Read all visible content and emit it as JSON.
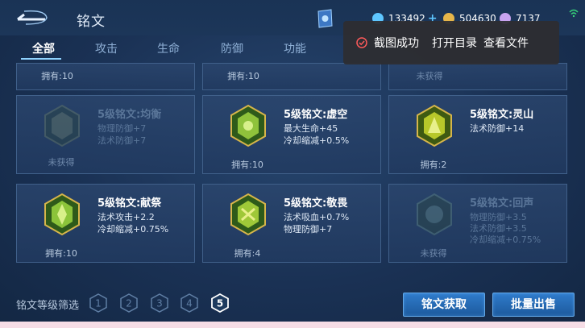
{
  "header": {
    "title": "铭文",
    "currencies": [
      {
        "icon": "diamond-icon",
        "value": "133492",
        "color": "#5ec6ff"
      },
      {
        "icon": "gold-coin-icon",
        "value": "504630",
        "color": "#e5b54a"
      },
      {
        "icon": "gem-icon",
        "value": "7137",
        "color": "#c8a3f0"
      }
    ]
  },
  "tabs": [
    {
      "label": "全部",
      "active": true
    },
    {
      "label": "攻击",
      "active": false
    },
    {
      "label": "生命",
      "active": false
    },
    {
      "label": "防御",
      "active": false
    },
    {
      "label": "功能",
      "active": false
    }
  ],
  "partial_row": [
    "拥有:10",
    "拥有:10",
    "未获得"
  ],
  "cards": [
    {
      "name": "5级铭文:均衡",
      "attrs": [
        "物理防御+7",
        "法术防御+7"
      ],
      "own": "未获得",
      "owned": false,
      "gem": "#7c8f6a"
    },
    {
      "name": "5级铭文:虚空",
      "attrs": [
        "最大生命+45",
        "冷却缩减+0.5%"
      ],
      "own": "拥有:10",
      "owned": true,
      "gem": "#8fc23b"
    },
    {
      "name": "5级铭文:灵山",
      "attrs": [
        "法术防御+14"
      ],
      "own": "拥有:2",
      "owned": true,
      "gem": "#b8c82a"
    },
    {
      "name": "5级铭文:献祭",
      "attrs": [
        "法术攻击+2.2",
        "冷却缩减+0.75%"
      ],
      "own": "拥有:10",
      "owned": true,
      "gem": "#8cc43a"
    },
    {
      "name": "5级铭文:敬畏",
      "attrs": [
        "法术吸血+0.7%",
        "物理防御+7"
      ],
      "own": "拥有:4",
      "owned": true,
      "gem": "#9fc838"
    },
    {
      "name": "5级铭文:回声",
      "attrs": [
        "物理防御+3.5",
        "法术防御+3.5",
        "冷却缩减+0.75%"
      ],
      "own": "未获得",
      "owned": false,
      "gem": "#6f9a8c"
    }
  ],
  "footer": {
    "filter_label": "铭文等级筛选",
    "levels": [
      "1",
      "2",
      "3",
      "4",
      "5"
    ],
    "selected_level": "5",
    "acquire_button": "铭文获取",
    "sell_button": "批量出售"
  },
  "toast": {
    "message": "截图成功",
    "open_dir": "打开目录",
    "view_file": "查看文件"
  }
}
